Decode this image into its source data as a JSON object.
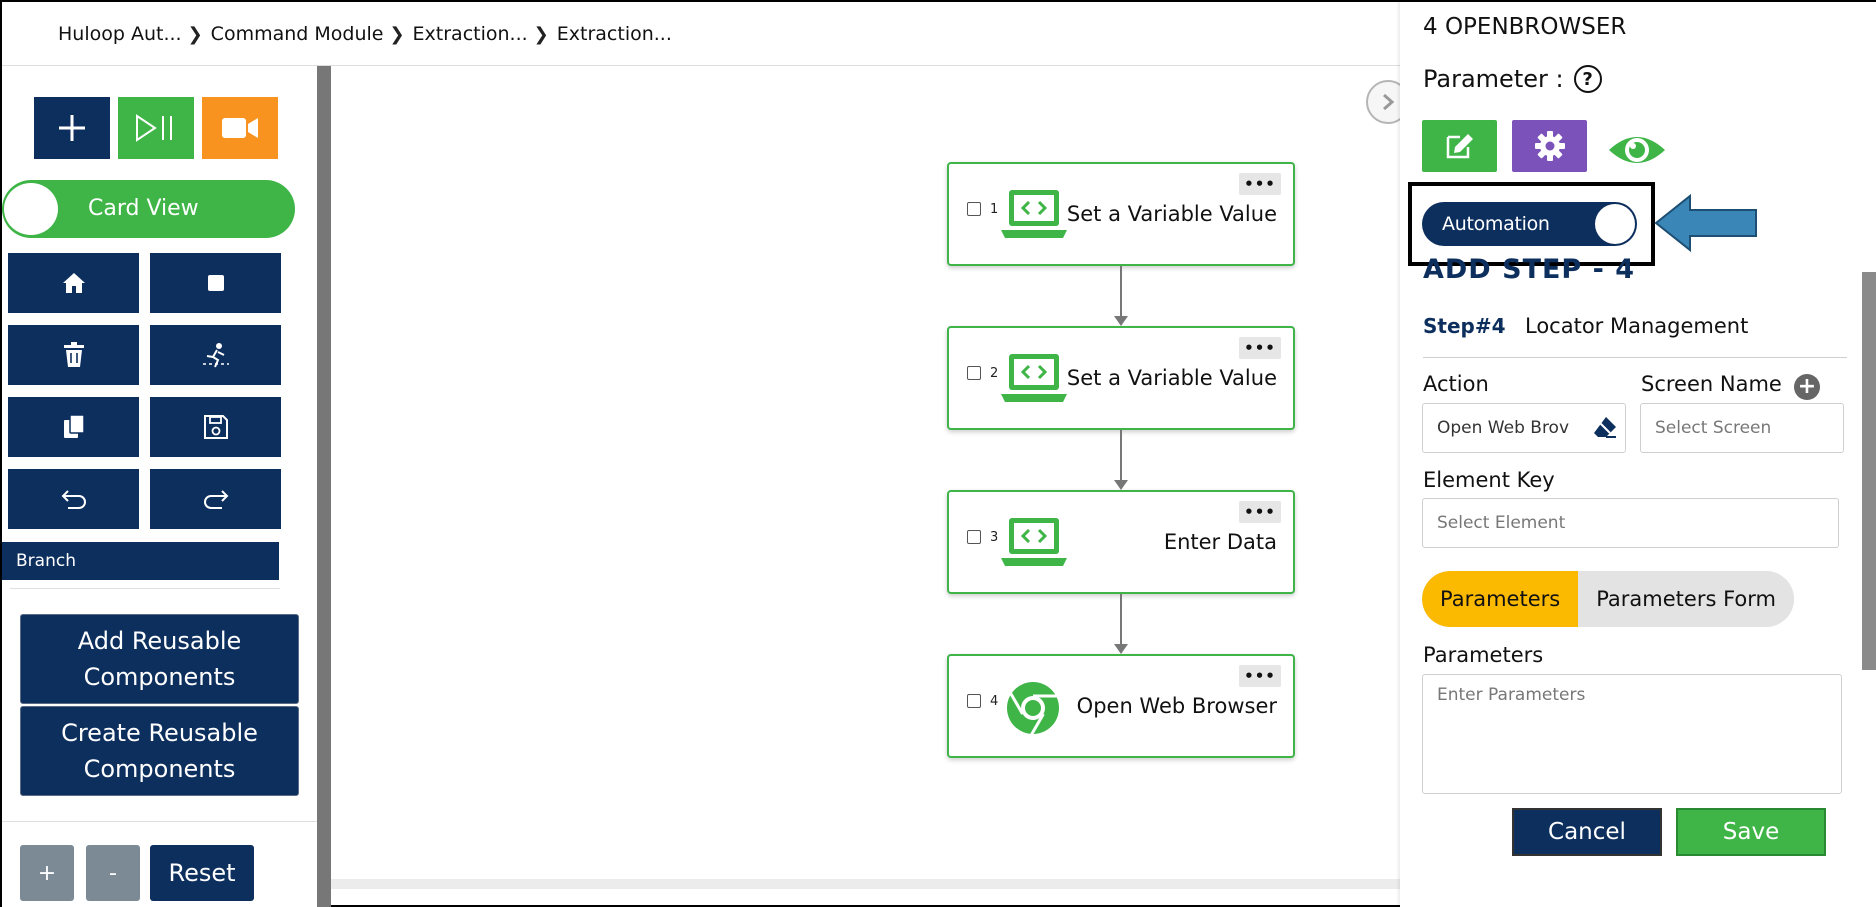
{
  "breadcrumb": [
    {
      "label": "Huloop Aut..."
    },
    {
      "label": "Command Module"
    },
    {
      "label": "Extraction..."
    },
    {
      "label": "Extraction..."
    }
  ],
  "toolbar": {
    "add_icon": "plus-icon",
    "run_icon": "play-pause-icon",
    "record_icon": "video-camera-icon",
    "colors": {
      "add": "#0d2f5e",
      "run": "#3fb548",
      "record": "#f7931e"
    }
  },
  "view_toggle": {
    "label": "Card View"
  },
  "grid_buttons": [
    {
      "icon": "home-icon"
    },
    {
      "icon": "stop-icon"
    },
    {
      "icon": "trash-icon"
    },
    {
      "icon": "run-person-icon"
    },
    {
      "icon": "copy-icon"
    },
    {
      "icon": "save-icon"
    },
    {
      "icon": "undo-icon"
    },
    {
      "icon": "redo-icon"
    }
  ],
  "branch": {
    "label": "Branch"
  },
  "reusable": {
    "add_label": "Add Reusable Components",
    "create_label": "Create Reusable Components"
  },
  "zoom": {
    "in_label": "+",
    "out_label": "-",
    "reset_label": "Reset"
  },
  "flow": {
    "steps": [
      {
        "number": "1",
        "title": "Set a Variable Value",
        "icon": "code-laptop-icon",
        "menu": "•••"
      },
      {
        "number": "2",
        "title": "Set a Variable Value",
        "icon": "code-laptop-icon",
        "menu": "•••"
      },
      {
        "number": "3",
        "title": "Enter Data",
        "icon": "code-laptop-icon",
        "menu": "•••"
      },
      {
        "number": "4",
        "title": "Open Web Browser",
        "icon": "chrome-icon",
        "menu": "•••"
      }
    ]
  },
  "panel": {
    "title": "4 OPENBROWSER",
    "parameter_label": "Parameter :",
    "help_symbol": "?",
    "automation_label": "Automation",
    "add_step": "ADD STEP - 4",
    "step_label": "Step#4",
    "step_desc": "Locator Management",
    "action_label": "Action",
    "action_value": "Open Web Brov",
    "screen_label": "Screen Name",
    "screen_placeholder": "Select Screen",
    "element_label": "Element Key",
    "element_placeholder": "Select Element",
    "tab_parameters": "Parameters",
    "tab_parameters_form": "Parameters Form",
    "parameters_label": "Parameters",
    "parameters_placeholder": "Enter Parameters",
    "cancel_label": "Cancel",
    "save_label": "Save"
  }
}
